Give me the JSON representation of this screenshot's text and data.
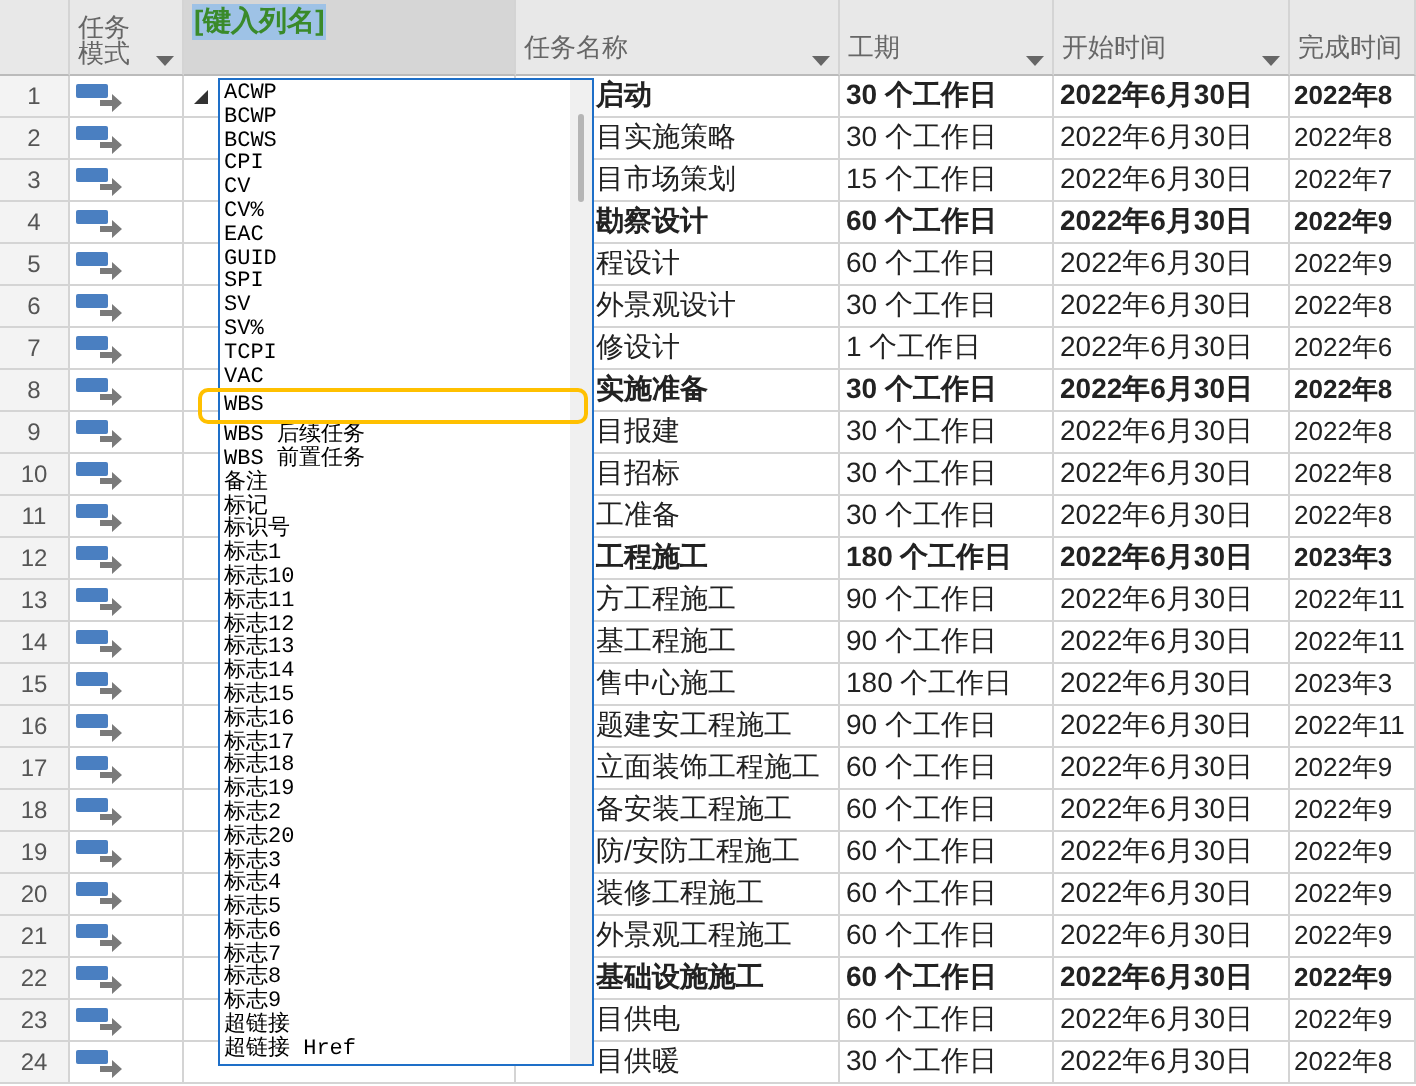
{
  "columns": [
    {
      "kind": "mode",
      "lines": [
        "任务",
        "模式"
      ],
      "filter": true
    },
    {
      "kind": "new",
      "lines": [
        "[键入列名]"
      ],
      "filter": false,
      "selected": true
    },
    {
      "kind": "name",
      "lines": [
        "任务名称"
      ],
      "filter": true
    },
    {
      "kind": "duration",
      "lines": [
        "工期"
      ],
      "filter": true
    },
    {
      "kind": "start",
      "lines": [
        "开始时间"
      ],
      "filter": true
    },
    {
      "kind": "finish",
      "lines": [
        "完成时间"
      ],
      "filter": false
    }
  ],
  "rows": [
    {
      "id": "1",
      "summary": true,
      "name": "启动",
      "duration": "30 个工作日",
      "start": "2022年6月30日",
      "finish": "2022年8"
    },
    {
      "id": "2",
      "summary": false,
      "name": "目实施策略",
      "duration": "30 个工作日",
      "start": "2022年6月30日",
      "finish": "2022年8"
    },
    {
      "id": "3",
      "summary": false,
      "name": "目市场策划",
      "duration": "15 个工作日",
      "start": "2022年6月30日",
      "finish": "2022年7"
    },
    {
      "id": "4",
      "summary": true,
      "name": "勘察设计",
      "duration": "60 个工作日",
      "start": "2022年6月30日",
      "finish": "2022年9"
    },
    {
      "id": "5",
      "summary": false,
      "name": "程设计",
      "duration": "60 个工作日",
      "start": "2022年6月30日",
      "finish": "2022年9"
    },
    {
      "id": "6",
      "summary": false,
      "name": "外景观设计",
      "duration": "30 个工作日",
      "start": "2022年6月30日",
      "finish": "2022年8"
    },
    {
      "id": "7",
      "summary": false,
      "name": "修设计",
      "duration": "1 个工作日",
      "start": "2022年6月30日",
      "finish": "2022年6"
    },
    {
      "id": "8",
      "summary": true,
      "name": "实施准备",
      "duration": "30 个工作日",
      "start": "2022年6月30日",
      "finish": "2022年8"
    },
    {
      "id": "9",
      "summary": false,
      "name": "目报建",
      "duration": "30 个工作日",
      "start": "2022年6月30日",
      "finish": "2022年8"
    },
    {
      "id": "10",
      "summary": false,
      "name": "目招标",
      "duration": "30 个工作日",
      "start": "2022年6月30日",
      "finish": "2022年8"
    },
    {
      "id": "11",
      "summary": false,
      "name": "工准备",
      "duration": "30 个工作日",
      "start": "2022年6月30日",
      "finish": "2022年8"
    },
    {
      "id": "12",
      "summary": true,
      "name": "工程施工",
      "duration": "180 个工作日",
      "start": "2022年6月30日",
      "finish": "2023年3"
    },
    {
      "id": "13",
      "summary": false,
      "name": "方工程施工",
      "duration": "90 个工作日",
      "start": "2022年6月30日",
      "finish": "2022年11"
    },
    {
      "id": "14",
      "summary": false,
      "name": "基工程施工",
      "duration": "90 个工作日",
      "start": "2022年6月30日",
      "finish": "2022年11"
    },
    {
      "id": "15",
      "summary": false,
      "name": "售中心施工",
      "duration": "180 个工作日",
      "start": "2022年6月30日",
      "finish": "2023年3"
    },
    {
      "id": "16",
      "summary": false,
      "name": "题建安工程施工",
      "duration": "90 个工作日",
      "start": "2022年6月30日",
      "finish": "2022年11"
    },
    {
      "id": "17",
      "summary": false,
      "name": "立面装饰工程施工",
      "duration": "60 个工作日",
      "start": "2022年6月30日",
      "finish": "2022年9"
    },
    {
      "id": "18",
      "summary": false,
      "name": "备安装工程施工",
      "duration": "60 个工作日",
      "start": "2022年6月30日",
      "finish": "2022年9"
    },
    {
      "id": "19",
      "summary": false,
      "name": "防/安防工程施工",
      "duration": "60 个工作日",
      "start": "2022年6月30日",
      "finish": "2022年9"
    },
    {
      "id": "20",
      "summary": false,
      "name": "装修工程施工",
      "duration": "60 个工作日",
      "start": "2022年6月30日",
      "finish": "2022年9"
    },
    {
      "id": "21",
      "summary": false,
      "name": "外景观工程施工",
      "duration": "60 个工作日",
      "start": "2022年6月30日",
      "finish": "2022年9"
    },
    {
      "id": "22",
      "summary": true,
      "name": "基础设施施工",
      "duration": "60 个工作日",
      "start": "2022年6月30日",
      "finish": "2022年9"
    },
    {
      "id": "23",
      "summary": false,
      "name": "目供电",
      "duration": "60 个工作日",
      "start": "2022年6月30日",
      "finish": "2022年9"
    },
    {
      "id": "24",
      "summary": false,
      "name": "目供暖",
      "duration": "30 个工作日",
      "start": "2022年6月30日",
      "finish": "2022年8"
    }
  ],
  "field_list": {
    "items": [
      {
        "label": "ACWP",
        "highlighted": false
      },
      {
        "label": "BCWP",
        "highlighted": false
      },
      {
        "label": "BCWS",
        "highlighted": false
      },
      {
        "label": "CPI",
        "highlighted": false
      },
      {
        "label": "CV",
        "highlighted": false
      },
      {
        "label": "CV%",
        "highlighted": false
      },
      {
        "label": "EAC",
        "highlighted": false
      },
      {
        "label": "GUID",
        "highlighted": false
      },
      {
        "label": "SPI",
        "highlighted": false
      },
      {
        "label": "SV",
        "highlighted": false
      },
      {
        "label": "SV%",
        "highlighted": false
      },
      {
        "label": "TCPI",
        "highlighted": false
      },
      {
        "label": "VAC",
        "highlighted": false
      },
      {
        "label": "WBS",
        "highlighted": true
      },
      {
        "label": "WBS 后续任务",
        "highlighted": false
      },
      {
        "label": "WBS 前置任务",
        "highlighted": false
      },
      {
        "label": "备注",
        "highlighted": false
      },
      {
        "label": "标记",
        "highlighted": false
      },
      {
        "label": "标识号",
        "highlighted": false
      },
      {
        "label": "标志1",
        "highlighted": false
      },
      {
        "label": "标志10",
        "highlighted": false
      },
      {
        "label": "标志11",
        "highlighted": false
      },
      {
        "label": "标志12",
        "highlighted": false
      },
      {
        "label": "标志13",
        "highlighted": false
      },
      {
        "label": "标志14",
        "highlighted": false
      },
      {
        "label": "标志15",
        "highlighted": false
      },
      {
        "label": "标志16",
        "highlighted": false
      },
      {
        "label": "标志17",
        "highlighted": false
      },
      {
        "label": "标志18",
        "highlighted": false
      },
      {
        "label": "标志19",
        "highlighted": false
      },
      {
        "label": "标志2",
        "highlighted": false
      },
      {
        "label": "标志20",
        "highlighted": false
      },
      {
        "label": "标志3",
        "highlighted": false
      },
      {
        "label": "标志4",
        "highlighted": false
      },
      {
        "label": "标志5",
        "highlighted": false
      },
      {
        "label": "标志6",
        "highlighted": false
      },
      {
        "label": "标志7",
        "highlighted": false
      },
      {
        "label": "标志8",
        "highlighted": false
      },
      {
        "label": "标志9",
        "highlighted": false
      },
      {
        "label": "超链接",
        "highlighted": false
      },
      {
        "label": "超链接 Href",
        "highlighted": false
      }
    ]
  }
}
